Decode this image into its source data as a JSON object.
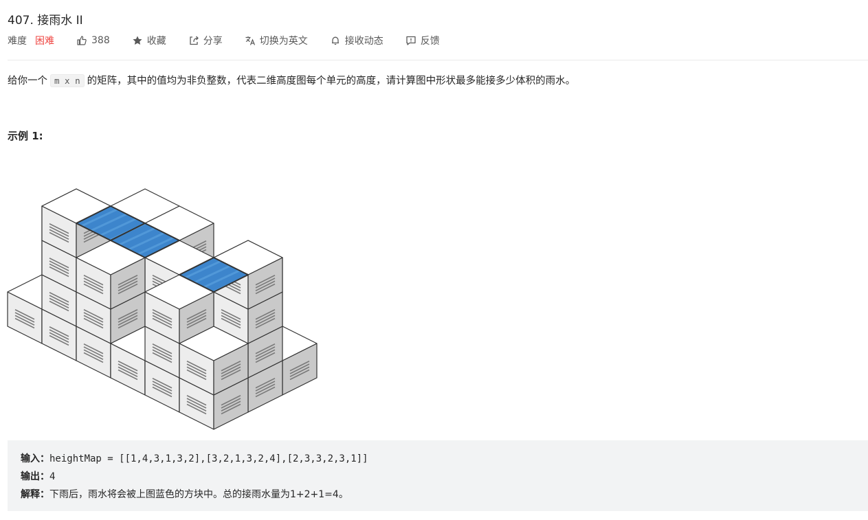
{
  "problem": {
    "title": "407. 接雨水 II"
  },
  "toolbar": {
    "difficulty_label": "难度",
    "difficulty": "困难",
    "likes": "388",
    "collect": "收藏",
    "share": "分享",
    "switch_lang": "切换为英文",
    "subscribe": "接收动态",
    "feedback": "反馈"
  },
  "description": {
    "before": "给你一个",
    "code": "m x n",
    "after": "的矩阵，其中的值均为非负整数，代表二维高度图每个单元的高度，请计算图中形状最多能接多少体积的雨水。"
  },
  "example": {
    "title": "示例 1:",
    "input_label": "输入：",
    "input_value": "heightMap = [[1,4,3,1,3,2],[3,2,1,3,2,4],[2,3,3,2,3,1]]",
    "output_label": "输出：",
    "output_value": "4",
    "explain_label": "解释：",
    "explain_value": "下雨后，雨水将会被上图蓝色的方块中。总的接雨水量为1+2+1=4。"
  },
  "colors": {
    "difficulty_hard": "#ef4743",
    "water": "#3d85cc",
    "text": "#262626",
    "muted": "#595959"
  }
}
